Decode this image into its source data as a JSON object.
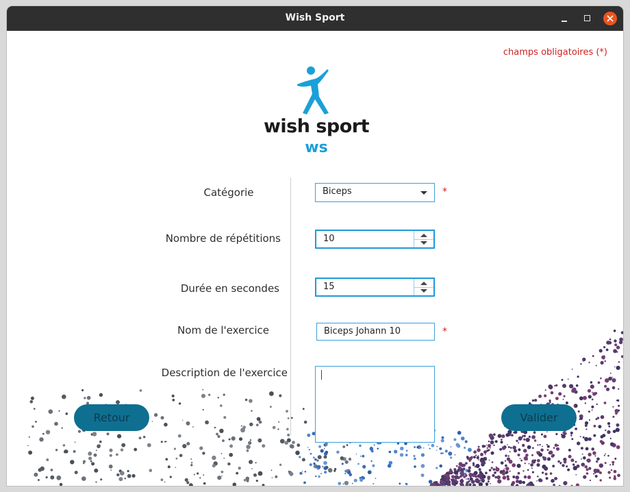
{
  "window": {
    "title": "Wish Sport"
  },
  "required_note": "champs obligatoires (*)",
  "logo": {
    "name": "wish sport",
    "initials": "ws"
  },
  "form": {
    "category": {
      "label": "Catégorie",
      "value": "Biceps",
      "required_mark": "*"
    },
    "repetitions": {
      "label": "Nombre de répétitions",
      "value": "10"
    },
    "duration": {
      "label": "Durée en secondes",
      "value": "15"
    },
    "exercise_name": {
      "label": "Nom de l'exercice",
      "value": "Biceps Johann 10",
      "required_mark": "*"
    },
    "description": {
      "label": "Description de l'exercice",
      "value": ""
    }
  },
  "buttons": {
    "back": "Retour",
    "validate": "Valider"
  },
  "colors": {
    "accent": "#1e9ad6",
    "button": "#0f6f90",
    "required": "#d02020",
    "logo_blue": "#1aa0d8",
    "close": "#e95420"
  }
}
